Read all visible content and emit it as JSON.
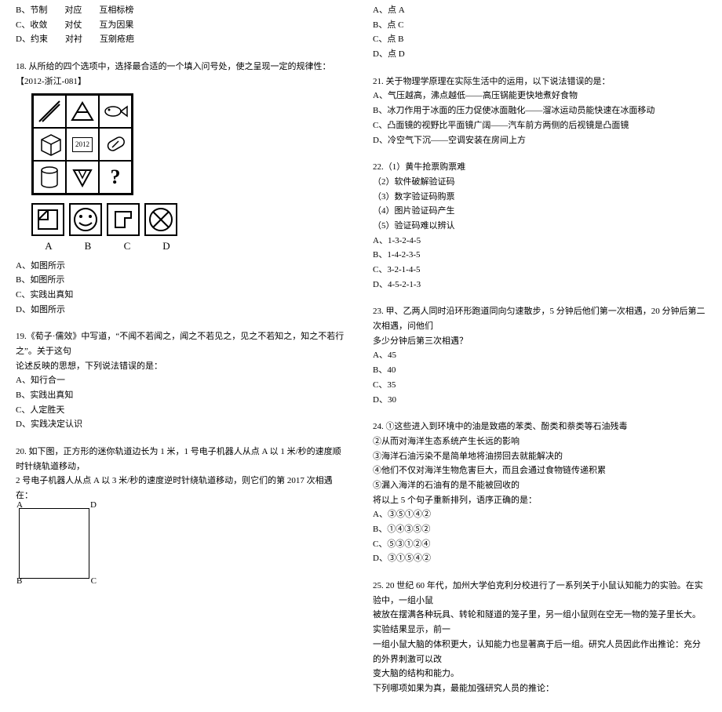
{
  "col1": {
    "opts17": {
      "b": "B、节制　　对应　　互相标榜",
      "c": "C、收敛　　对仗　　互为因果",
      "d": "D、约束　　对衬　　互剜疮疤"
    },
    "q18": {
      "stem": "18. 从所给的四个选项中，选择最合适的一个填入问号处，使之呈现一定的规律性：【2012-浙江-081】",
      "year": "2012",
      "optA": "A、如图所示",
      "optB": "B、如图所示",
      "optC": "C、实践出真知",
      "optD": "D、如图所示",
      "labelA": "A",
      "labelB": "B",
      "labelC": "C",
      "labelD": "D"
    },
    "q19": {
      "stem1": "19.《荀子·儒效》中写道，“不闻不若闻之，闻之不若见之，见之不若知之，知之不若行之”。关于这句",
      "stem2": "论述反映的思想，下列说法错误的是：",
      "a": "A、知行合一",
      "b": "B、实践出真知",
      "c": "C、人定胜天",
      "d": "D、实践决定认识"
    },
    "q20": {
      "stem1": "20. 如下图，正方形的迷你轨道边长为 1 米，1 号电子机器人从点 A 以 1 米/秒的速度顺时针绕轨道移动，",
      "stem2": "2 号电子机器人从点 A 以 3 米/秒的速度逆时针绕轨道移动，则它们的第 2017 次相遇在：",
      "A": "A",
      "B": "B",
      "C": "C",
      "D": "D"
    }
  },
  "col2": {
    "opts20": {
      "a": "A、点 A",
      "b": "B、点 C",
      "c": "C、点 B",
      "d": "D、点 D"
    },
    "q21": {
      "stem": "21. 关于物理学原理在实际生活中的运用，以下说法错误的是：",
      "a": "A、气压越高，沸点越低——高压锅能更快地煮好食物",
      "b": "B、冰刀作用于冰面的压力促使冰面融化——溜冰运动员能快速在冰面移动",
      "c": "C、凸面镜的视野比平面镜广阔——汽车前方两侧的后视镜是凸面镜",
      "d": "D、冷空气下沉——空调安装在房间上方"
    },
    "q22": {
      "l1": "22.（1）黄牛抢票购票难",
      "l2": "（2）软件破解验证码",
      "l3": "（3）数字验证码购票",
      "l4": "（4）图片验证码产生",
      "l5": "（5）验证码难以辨认",
      "a": "A、1-3-2-4-5",
      "b": "B、1-4-2-3-5",
      "c": "C、3-2-1-4-5",
      "d": "D、4-5-2-1-3"
    },
    "q23": {
      "stem1": "23. 甲、乙两人同时沿环形跑道同向匀速散步，5 分钟后他们第一次相遇，20 分钟后第二次相遇，问他们",
      "stem2": "多少分钟后第三次相遇？",
      "a": "A、45",
      "b": "B、40",
      "c": "C、35",
      "d": "D、30"
    },
    "q24": {
      "l1": "24. ①这些进入到环境中的油是致癌的苯类、酚类和萘类等石油残毒",
      "l2": "②从而对海洋生态系统产生长远的影响",
      "l3": "③海洋石油污染不是简单地将油捞回去就能解决的",
      "l4": "④他们不仅对海洋生物危害巨大，而且会通过食物链传递积累",
      "l5": "⑤漏入海洋的石油有的是不能被回收的",
      "l6": "将以上 5 个句子重新排列，语序正确的是：",
      "a": "A、③⑤①④②",
      "b": "B、①④③⑤②",
      "c": "C、⑤③①②④",
      "d": "D、③①⑤④②"
    },
    "q25": {
      "l1": "25. 20 世纪 60 年代，加州大学伯克利分校进行了一系列关于小鼠认知能力的实验。在实验中，一组小鼠",
      "l2": "被放在摆满各种玩具、转轮和隧道的笼子里，另一组小鼠则在空无一物的笼子里长大。实验结果显示，前一",
      "l3": "一组小鼠大脑的体积更大，认知能力也显著高于后一组。研究人员因此作出推论：充分的外界刺激可以改",
      "l4": "变大脑的结构和能力。",
      "l5": "下列哪项如果为真，最能加强研究人员的推论："
    }
  }
}
